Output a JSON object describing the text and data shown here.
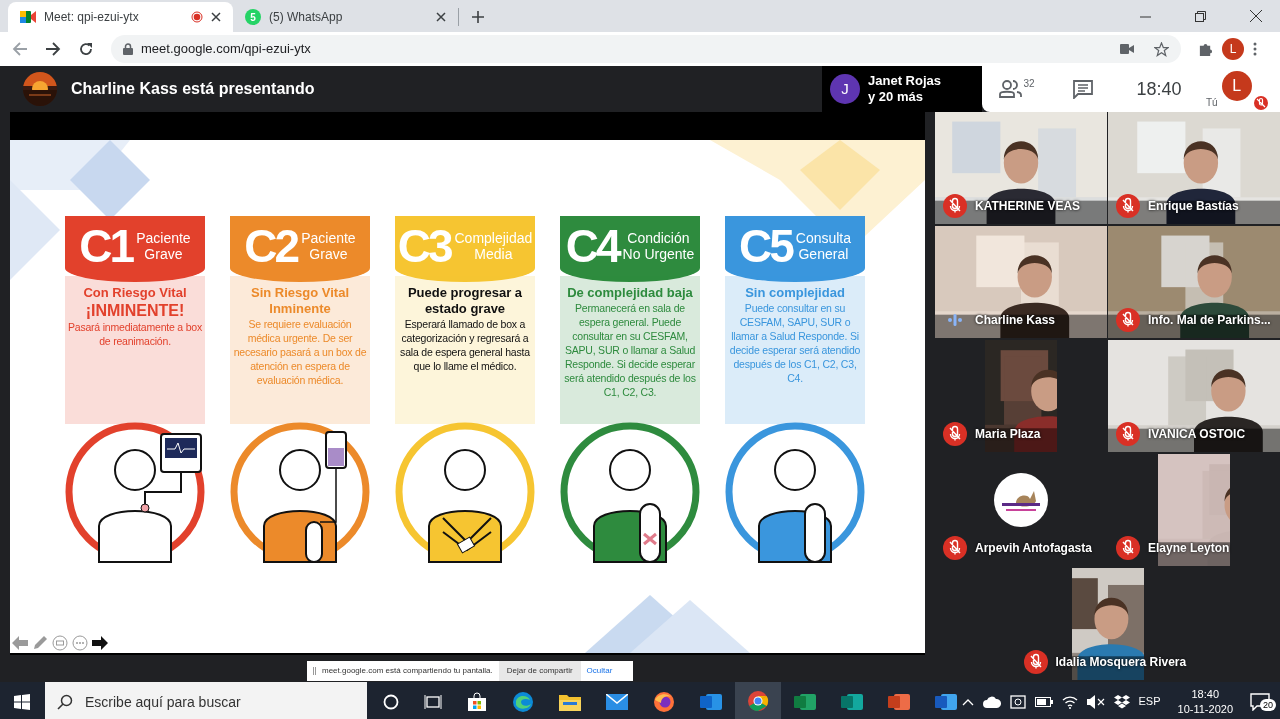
{
  "browser": {
    "tabs": [
      {
        "title": "Meet: qpi-ezui-ytx",
        "selected": true,
        "recording": true
      },
      {
        "title": "(5) WhatsApp",
        "favicon_badge": "5",
        "selected": false,
        "recording": false
      }
    ],
    "address": "meet.google.com/qpi-ezui-ytx",
    "profile_initial": "L"
  },
  "meeting": {
    "presenter": "Charline Kass está presentando",
    "others": {
      "initial": "J",
      "name": "Janet Rojas",
      "more": "y 20 más"
    },
    "people_count": "32",
    "clock": "18:40",
    "self": {
      "initial": "L",
      "label": "Tú",
      "muted": true
    }
  },
  "slide": {
    "cards": [
      {
        "code": "C1",
        "title_lines": [
          "Paciente",
          "Grave"
        ],
        "color": "#e2412c",
        "heading": "Con Riesgo Vital",
        "alert": "¡INMINENTE!",
        "body": "Pasará inmediatamente a box de reanimación.",
        "kind": "monitor"
      },
      {
        "code": "C2",
        "title_lines": [
          "Paciente",
          "Grave"
        ],
        "color": "#ec8a2a",
        "heading": "Sin Riesgo Vital Inminente",
        "body": "Se requiere evaluación médica urgente. De ser necesario pasará a un box de atención en espera de evaluación médica.",
        "kind": "iv"
      },
      {
        "code": "C3",
        "title_lines": [
          "Complejidad",
          "Media"
        ],
        "color": "#f6c531",
        "heading": "Puede progresar a estado grave",
        "body": "Esperará llamado de box a categorización y regresará a sala de espera general hasta que lo llame el médico.",
        "kind": "arms"
      },
      {
        "code": "C4",
        "title_lines": [
          "Condición",
          "No Urgente"
        ],
        "color": "#2e8b3e",
        "heading": "De complejidad baja",
        "body": "Permanecerá en sala de espera general. Puede consultar en su CESFAM, SAPU, SUR o llamar a Salud Responde. Si decide esperar será atendido después de los C1, C2, C3.",
        "kind": "bandage"
      },
      {
        "code": "C5",
        "title_lines": [
          "Consulta",
          "General"
        ],
        "color": "#3a96dd",
        "heading": "Sin complejidad",
        "body": "Puede consultar en su CESFAM, SAPU, SUR o llamar a Salud Responde. Si decide esperar será atendido después de los C1, C2, C3, C4.",
        "kind": "plain"
      }
    ]
  },
  "share_bar": {
    "message": "meet.google.com está compartiendo tu pantalla.",
    "stop_button": "Dejar de compartir",
    "hide_link": "Ocultar"
  },
  "participants": [
    {
      "name": "KATHERINE VEAS",
      "muted": true,
      "kind": "video"
    },
    {
      "name": "Enrique Bastías",
      "muted": true,
      "kind": "video"
    },
    {
      "name": "Charline Kass",
      "muted": false,
      "kind": "video"
    },
    {
      "name": "Info. Mal de Parkins...",
      "muted": true,
      "kind": "video"
    },
    {
      "name": "Maria Plaza",
      "muted": true,
      "kind": "narrow_video"
    },
    {
      "name": "IVANICA OSTOIC",
      "muted": true,
      "kind": "video"
    },
    {
      "name": "Arpevih Antofagasta",
      "muted": true,
      "kind": "logo"
    },
    {
      "name": "Elayne Leyton",
      "muted": true,
      "kind": "narrow_video"
    },
    {
      "name": "Idalia Mosquera Rivera",
      "muted": true,
      "kind": "narrow_video"
    }
  ],
  "taskbar": {
    "search_placeholder": "Escribe aquí para buscar",
    "language": "ESP",
    "time": "18:40",
    "date": "10-11-2020",
    "notifications": "20"
  }
}
